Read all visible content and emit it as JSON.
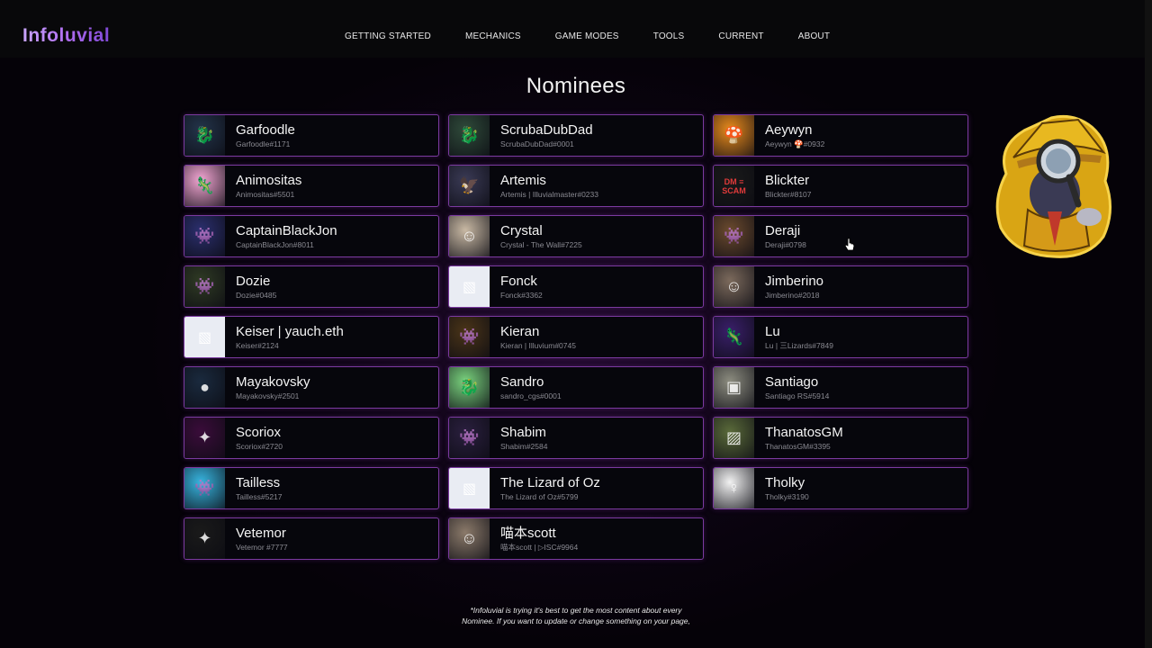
{
  "header": {
    "logo": "Infoluvial",
    "nav": [
      "GETTING STARTED",
      "MECHANICS",
      "GAME MODES",
      "TOOLS",
      "CURRENT",
      "ABOUT"
    ]
  },
  "main": {
    "title": "Nominees",
    "nominees": [
      {
        "name": "Garfoodle",
        "tag": "Garfoodle#1171",
        "avatar": "dragon-avatar",
        "color": "#23344a"
      },
      {
        "name": "ScrubaDubDad",
        "tag": "ScrubaDubDad#0001",
        "avatar": "dragon-avatar",
        "color": "#2f4a3a"
      },
      {
        "name": "Aeywyn",
        "tag": "Aeywyn 🍄#0932",
        "avatar": "mushroom-avatar",
        "color": "#e88a1c"
      },
      {
        "name": "Animositas",
        "tag": "Animositas#5501",
        "avatar": "lizard-avatar",
        "color": "#f2a5d2"
      },
      {
        "name": "Artemis",
        "tag": "Artemis | Illuvialmaster#0233",
        "avatar": "bird-avatar",
        "color": "#3a3a55"
      },
      {
        "name": "Blickter",
        "tag": "Blickter#8107",
        "avatar": "text-avatar",
        "color": "#1a1a1a"
      },
      {
        "name": "CaptainBlackJon",
        "tag": "CaptainBlackJon#8011",
        "avatar": "creature-avatar",
        "color": "#2b2f6e"
      },
      {
        "name": "Crystal",
        "tag": "Crystal - The Wall#7225",
        "avatar": "photo-avatar",
        "color": "#c9b9a4"
      },
      {
        "name": "Deraji",
        "tag": "Deraji#0798",
        "avatar": "creature-avatar",
        "color": "#6b4a2e"
      },
      {
        "name": "Dozie",
        "tag": "Dozie#0485",
        "avatar": "creature-avatar",
        "color": "#2f3a24"
      },
      {
        "name": "Fonck",
        "tag": "Fonck#3362",
        "avatar": "placeholder-image-icon",
        "color": "#e9ecf3"
      },
      {
        "name": "Jimberino",
        "tag": "Jimberino#2018",
        "avatar": "photo-avatar",
        "color": "#7c6a5c"
      },
      {
        "name": "Keiser | yauch.eth",
        "tag": "Keiser#2124",
        "avatar": "placeholder-image-icon",
        "color": "#e9ecf3"
      },
      {
        "name": "Kieran",
        "tag": "Kieran | Illuvium#0745",
        "avatar": "creature-avatar",
        "color": "#4a3418"
      },
      {
        "name": "Lu",
        "tag": "Lu | 三Lizards#7849",
        "avatar": "lizard-avatar",
        "color": "#3a1f6a"
      },
      {
        "name": "Mayakovsky",
        "tag": "Mayakovsky#2501",
        "avatar": "orb-avatar",
        "color": "#1a2a3e"
      },
      {
        "name": "Sandro",
        "tag": "sandro_cgs#0001",
        "avatar": "dragon-avatar",
        "color": "#7ad37e"
      },
      {
        "name": "Santiago",
        "tag": "Santiago RS#5914",
        "avatar": "pixel-avatar",
        "color": "#8d8d80"
      },
      {
        "name": "Scoriox",
        "tag": "Scoriox#2720",
        "avatar": "emblem-avatar",
        "color": "#3a0c3a"
      },
      {
        "name": "Shabim",
        "tag": "Shabim#2584",
        "avatar": "creature-avatar",
        "color": "#2a1f3e"
      },
      {
        "name": "ThanatosGM",
        "tag": "ThanatosGM#3395",
        "avatar": "art-avatar",
        "color": "#5a6a3a"
      },
      {
        "name": "Tailless",
        "tag": "Tailless#5217",
        "avatar": "creature-avatar",
        "color": "#37b5e0"
      },
      {
        "name": "The Lizard of Oz",
        "tag": "The Lizard of Oz#5799",
        "avatar": "placeholder-image-icon",
        "color": "#e9ecf3"
      },
      {
        "name": "Tholky",
        "tag": "Tholky#3190",
        "avatar": "figure-avatar",
        "color": "#f2f2f2"
      },
      {
        "name": "Vetemor",
        "tag": "Vetemor #7777",
        "avatar": "emblem-avatar",
        "color": "#1a1a1a"
      },
      {
        "name": "喵本scott",
        "tag": "喵本scott | ▷ISC#9964",
        "avatar": "photo-avatar",
        "color": "#8b7a6a"
      }
    ]
  },
  "avatar_text": {
    "blickter": "DM ≡ SCAM"
  },
  "footnote": {
    "line1": "*Infoluvial is trying it's best to get the most content about every",
    "line2": "Nominee. If you want to update or change something on your page,"
  },
  "mascot": {
    "icon": "detective-mascot-icon"
  },
  "colors": {
    "card_border": "#7b3aa0",
    "card_bg": "#06060c",
    "logo_gradient": [
      "#c9a6ff",
      "#7f49d6"
    ]
  }
}
